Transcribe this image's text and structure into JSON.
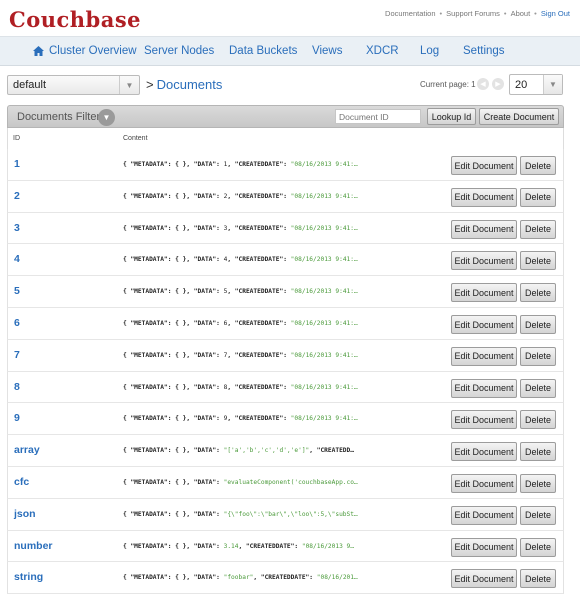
{
  "header": {
    "logo_text": "Couchbase",
    "links": [
      "Documentation",
      "Support Forums",
      "About",
      "Sign Out"
    ],
    "separator": "•"
  },
  "nav": {
    "items": [
      "Cluster Overview",
      "Server Nodes",
      "Data Buckets",
      "Views",
      "XDCR",
      "Log",
      "Settings"
    ]
  },
  "toolbar": {
    "bucket": "default",
    "breadcrumb_sep": ">",
    "breadcrumb": "Documents",
    "current_page_label": "Current page: 1",
    "page_size": "20"
  },
  "filter": {
    "label": "Documents Filter",
    "docid_placeholder": "Document ID",
    "lookup_label": "Lookup Id",
    "create_label": "Create Document"
  },
  "table": {
    "headers": {
      "id": "ID",
      "content": "Content"
    },
    "edit_label": "Edit Document",
    "delete_label": "Delete",
    "rows": [
      {
        "id": "1",
        "k1": "{ \"METADATA\": { }, \"DATA\": ",
        "v": "1",
        "vtype": "n",
        "k2": ", \"CREATEDDATE\": ",
        "rest": "\"08/16/2013 9:41:…"
      },
      {
        "id": "2",
        "k1": "{ \"METADATA\": { }, \"DATA\": ",
        "v": "2",
        "vtype": "n",
        "k2": ", \"CREATEDDATE\": ",
        "rest": "\"08/16/2013 9:41:…"
      },
      {
        "id": "3",
        "k1": "{ \"METADATA\": { }, \"DATA\": ",
        "v": "3",
        "vtype": "n",
        "k2": ", \"CREATEDDATE\": ",
        "rest": "\"08/16/2013 9:41:…"
      },
      {
        "id": "4",
        "k1": "{ \"METADATA\": { }, \"DATA\": ",
        "v": "4",
        "vtype": "n",
        "k2": ", \"CREATEDDATE\": ",
        "rest": "\"08/16/2013 9:41:…"
      },
      {
        "id": "5",
        "k1": "{ \"METADATA\": { }, \"DATA\": ",
        "v": "5",
        "vtype": "n",
        "k2": ", \"CREATEDDATE\": ",
        "rest": "\"08/16/2013 9:41:…"
      },
      {
        "id": "6",
        "k1": "{ \"METADATA\": { }, \"DATA\": ",
        "v": "6",
        "vtype": "n",
        "k2": ", \"CREATEDDATE\": ",
        "rest": "\"08/16/2013 9:41:…"
      },
      {
        "id": "7",
        "k1": "{ \"METADATA\": { }, \"DATA\": ",
        "v": "7",
        "vtype": "n",
        "k2": ", \"CREATEDDATE\": ",
        "rest": "\"08/16/2013 9:41:…"
      },
      {
        "id": "8",
        "k1": "{ \"METADATA\": { }, \"DATA\": ",
        "v": "8",
        "vtype": "n",
        "k2": ", \"CREATEDDATE\": ",
        "rest": "\"08/16/2013 9:41:…"
      },
      {
        "id": "9",
        "k1": "{ \"METADATA\": { }, \"DATA\": ",
        "v": "9",
        "vtype": "n",
        "k2": ", \"CREATEDDATE\": ",
        "rest": "\"08/16/2013 9:41:…"
      },
      {
        "id": "array",
        "k1": "{ \"METADATA\": { }, \"DATA\": ",
        "v": "\"['a','b','c','d','e']\"",
        "vtype": "s",
        "k2": ", \"CREATEDD…",
        "rest": ""
      },
      {
        "id": "cfc",
        "k1": "{ \"METADATA\": { }, \"DATA\": ",
        "v": "\"evaluateComponent('couchbaseApp.co…",
        "vtype": "s",
        "k2": "",
        "rest": ""
      },
      {
        "id": "json",
        "k1": "{ \"METADATA\": { }, \"DATA\": ",
        "v": "\"{\\\"foo\\\":\\\"bar\\\",\\\"loo\\\":5,\\\"subSt…",
        "vtype": "s",
        "k2": "",
        "rest": ""
      },
      {
        "id": "number",
        "k1": "{ \"METADATA\": { }, \"DATA\": ",
        "v": "3.14",
        "vtype": "s",
        "k2": ", \"CREATEDDATE\": ",
        "rest": "\"08/16/2013 9…"
      },
      {
        "id": "string",
        "k1": "{ \"METADATA\": { }, \"DATA\": ",
        "v": "\"foobar\"",
        "vtype": "s",
        "k2": ", \"CREATEDDATE\": ",
        "rest": "\"08/16/201…"
      }
    ]
  },
  "colors": {
    "brand": "#b01f24",
    "link": "#2a6ebb",
    "string": "#4a9a3a"
  }
}
